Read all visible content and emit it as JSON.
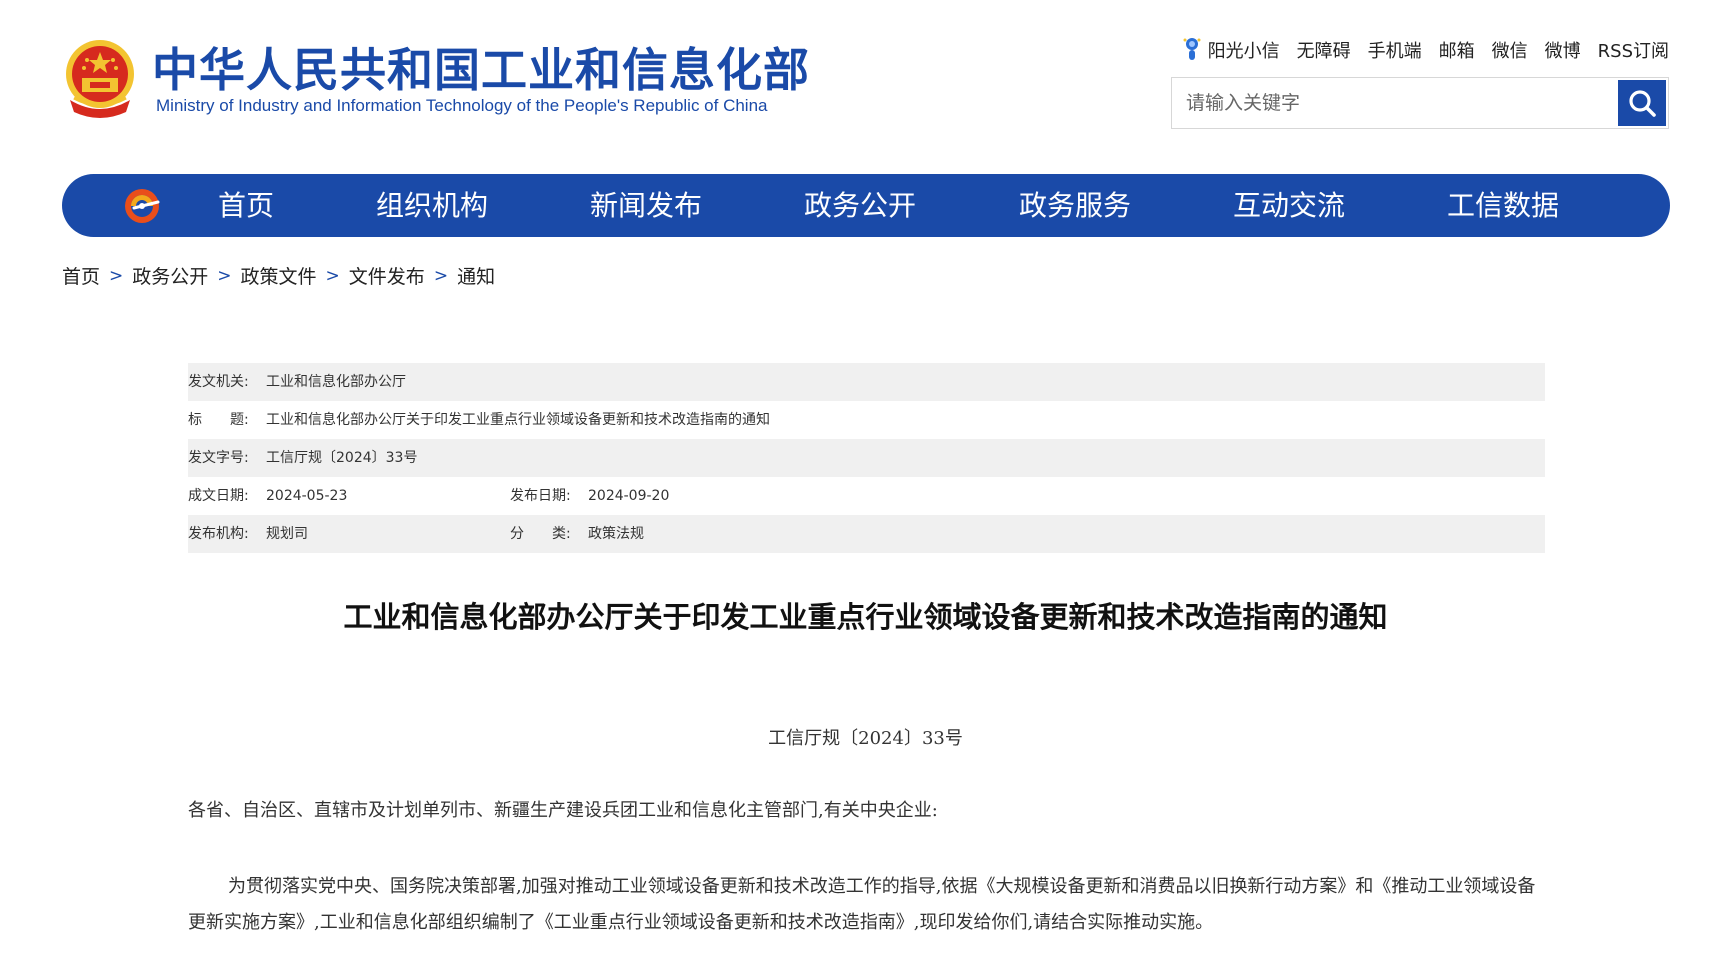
{
  "header": {
    "title_cn": "中华人民共和国工业和信息化部",
    "title_en": "Ministry of Industry and Information Technology of the People's Republic of China",
    "top_links": [
      "阳光小信",
      "无障碍",
      "手机端",
      "邮箱",
      "微信",
      "微博",
      "RSS订阅"
    ],
    "search_placeholder": "请输入关键字"
  },
  "nav": {
    "items": [
      "首页",
      "组织机构",
      "新闻发布",
      "政务公开",
      "政务服务",
      "互动交流",
      "工信数据"
    ]
  },
  "breadcrumb": [
    "首页",
    "政务公开",
    "政策文件",
    "文件发布",
    "通知"
  ],
  "breadcrumb_sep": ">",
  "info": {
    "issuer_label": "发文机关:",
    "issuer": "工业和信息化部办公厅",
    "title_label": "标　　题:",
    "title": "工业和信息化部办公厅关于印发工业重点行业领域设备更新和技术改造指南的通知",
    "doc_no_label": "发文字号:",
    "doc_no": "工信厅规〔2024〕33号",
    "created_label": "成文日期:",
    "created": "2024-05-23",
    "published_label": "发布日期:",
    "published": "2024-09-20",
    "org_label": "发布机构:",
    "org": "规划司",
    "category_label": "分　　类:",
    "category": "政策法规"
  },
  "article": {
    "title": "工业和信息化部办公厅关于印发工业重点行业领域设备更新和技术改造指南的通知",
    "doc_number": "工信厅规〔2024〕33号",
    "salutation": "各省、自治区、直辖市及计划单列市、新疆生产建设兵团工业和信息化主管部门,有关中央企业:",
    "paragraph": "为贯彻落实党中央、国务院决策部署,加强对推动工业领域设备更新和技术改造工作的指导,依据《大规模设备更新和消费品以旧换新行动方案》和《推动工业领域设备更新实施方案》,工业和信息化部组织编制了《工业重点行业领域设备更新和技术改造指南》,现印发给你们,请结合实际推动实施。"
  },
  "colors": {
    "brand_blue": "#1a4aa8",
    "emblem_red": "#d62a1e",
    "emblem_gold": "#f3c431",
    "info_shade": "#f0f0f0"
  }
}
